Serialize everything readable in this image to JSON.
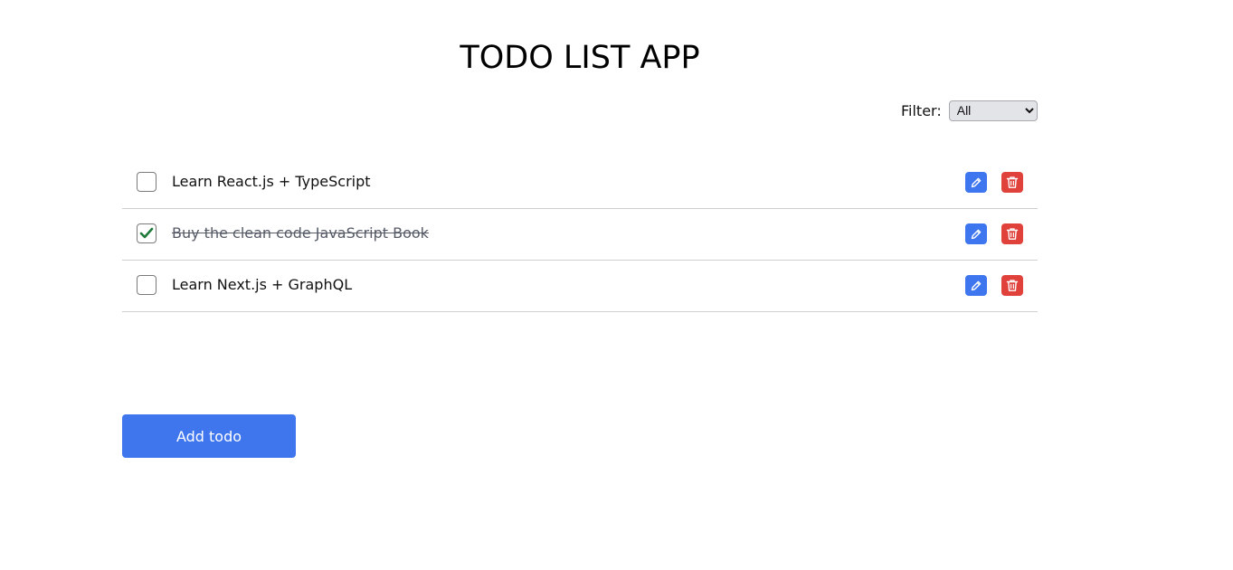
{
  "app": {
    "title": "TODO LIST APP"
  },
  "filter": {
    "label": "Filter:",
    "selected": "All",
    "options": [
      "All"
    ]
  },
  "todos": [
    {
      "text": "Learn React.js + TypeScript",
      "completed": false
    },
    {
      "text": "Buy the clean code JavaScript Book",
      "completed": true
    },
    {
      "text": "Learn Next.js + GraphQL",
      "completed": false
    }
  ],
  "actions": {
    "add_label": "Add todo",
    "edit_icon": "pencil-icon",
    "delete_icon": "trash-icon"
  },
  "colors": {
    "accent": "#3f76ee",
    "danger": "#e0413b",
    "check": "#1f7a3a"
  }
}
